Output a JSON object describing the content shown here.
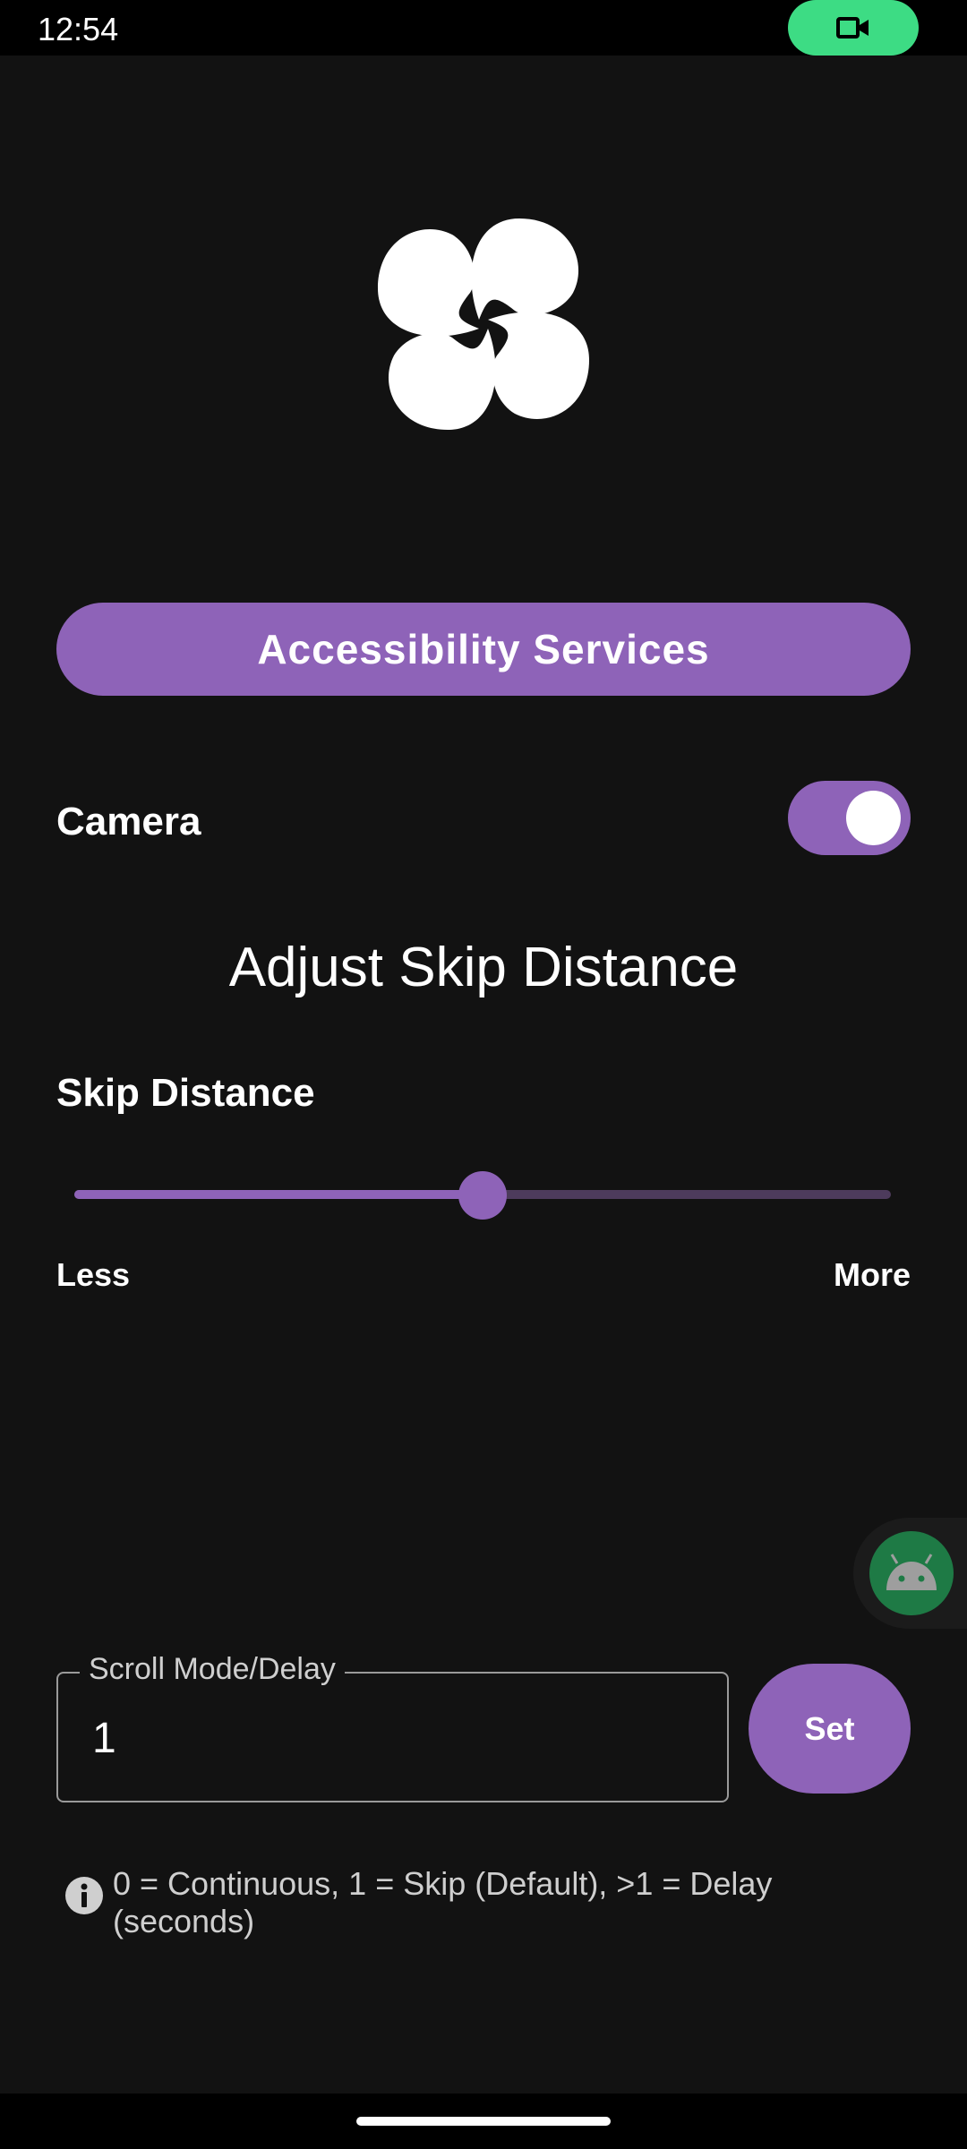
{
  "status_bar": {
    "time": "12:54",
    "recording_icon": "video-camera-icon",
    "recording_color": "#3ddc84"
  },
  "logo": {
    "icon": "pinwheel-logo-icon"
  },
  "accessibility_button": {
    "label": "Accessibility Services"
  },
  "camera": {
    "label": "Camera",
    "toggle_on": true
  },
  "section": {
    "title": "Adjust Skip Distance"
  },
  "skip_distance": {
    "label": "Skip Distance",
    "value_fraction": 0.5,
    "min_label": "Less",
    "max_label": "More"
  },
  "floating_bubble": {
    "icon": "android-robot-icon"
  },
  "scroll_delay": {
    "label": "Scroll Mode/Delay",
    "value": "1",
    "set_label": "Set"
  },
  "hint": {
    "icon": "info-icon",
    "text": "0 = Continuous, 1 = Skip (Default), >1 = Delay (seconds)"
  },
  "colors": {
    "accent": "#8e63b8",
    "background": "#121212",
    "track_inactive": "#4d3b5c"
  }
}
